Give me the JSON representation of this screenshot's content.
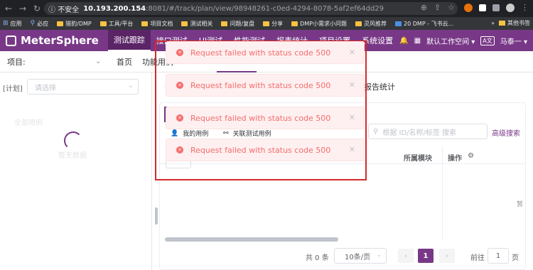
{
  "browser": {
    "security_label": "不安全",
    "host": "10.193.200.154",
    "path": ":8081/#/track/plan/view/98948261-c0ed-4294-8078-5af2ef64dd29",
    "bookmarks": [
      {
        "label": "应用",
        "icon": "apps-grid-icon"
      },
      {
        "label": "必应",
        "icon": "bing-icon"
      },
      {
        "label": "猎豹/DMP",
        "icon": "folder-icon"
      },
      {
        "label": "工具/平台",
        "icon": "folder-icon"
      },
      {
        "label": "项目文档",
        "icon": "folder-icon"
      },
      {
        "label": "测试相关",
        "icon": "folder-icon"
      },
      {
        "label": "问题/复盘",
        "icon": "folder-icon"
      },
      {
        "label": "分享",
        "icon": "folder-icon"
      },
      {
        "label": "DMP小需求小问题",
        "icon": "folder-icon"
      },
      {
        "label": "灵风推荐",
        "icon": "folder-icon"
      },
      {
        "label": "20 DMP - 飞书云...",
        "icon": "feishu-icon"
      }
    ],
    "other_bookmarks": "其他书签"
  },
  "app": {
    "logo": "MeterSphere",
    "menu": [
      "测试跟踪",
      "接口测试",
      "UI测试",
      "性能测试",
      "报表统计",
      "项目设置",
      "系统设置"
    ],
    "active_menu_index": 0,
    "workspace": "默认工作空间",
    "user": "马泰一"
  },
  "subbar": {
    "project_label": "项目:",
    "home": "首页",
    "function": "功能用例"
  },
  "left": {
    "plan_label": "[计划]",
    "plan_placeholder": "请选择",
    "ghost_top": "全部用例",
    "ghost_loading": "暂无数据"
  },
  "main": {
    "report_tab": "报告统计",
    "tab_mine": "我的用例",
    "tab_assoc": "关联测试用例",
    "search_placeholder": "根据 ID/名称/标签 搜索",
    "advanced_search": "高级搜索",
    "col_module": "所属模块",
    "col_ops": "操作",
    "empty_text": "暂",
    "pager": {
      "total": "共 0 条",
      "page_size": "10条/页",
      "current_page": "1",
      "goto_label": "前往",
      "goto_value": "1",
      "page_unit": "页"
    }
  },
  "toasts": [
    {
      "message": "Request failed with status code 500"
    },
    {
      "message": "Request failed with status code 500"
    },
    {
      "message": "Request failed with status code 500"
    },
    {
      "message": "Request failed with status code 500"
    }
  ],
  "colors": {
    "brand": "#783887",
    "error": "#f56c6c",
    "error_bg": "#fef0f0",
    "highlight_frame": "#d42a2a"
  }
}
